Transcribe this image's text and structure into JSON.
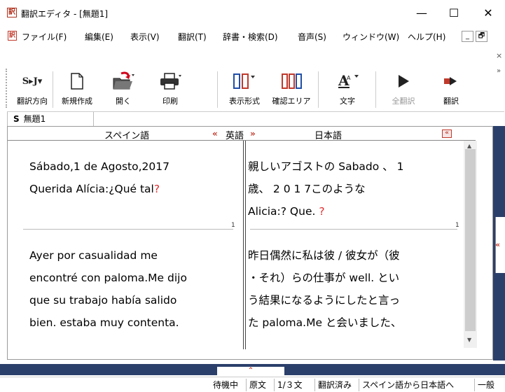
{
  "window": {
    "app_icon": "訳",
    "title": "翻訳エディタ - [無題1]",
    "minimize": "—",
    "maximize": "☐",
    "close": "✕"
  },
  "menu": {
    "doc_icon": "訳",
    "items": [
      "ファイル(F)",
      "編集(E)",
      "表示(V)",
      "翻訳(T)",
      "辞書・検索(D)",
      "音声(S)",
      "ウィンドウ(W)",
      "ヘルプ(H)"
    ],
    "mdi_min": "_",
    "mdi_restore": "🗗"
  },
  "toolbar": {
    "close": "×",
    "more": "»",
    "buttons": [
      {
        "label": "翻訳方向",
        "icon": "S▸J▾"
      },
      {
        "label": "新規作成",
        "icon": "new-doc-icon"
      },
      {
        "label": "開く",
        "icon": "open-folder-icon"
      },
      {
        "label": "印刷",
        "icon": "printer-icon"
      },
      {
        "label": "表示形式",
        "icon": "display-format-icon"
      },
      {
        "label": "確認エリア",
        "icon": "confirm-area-icon"
      },
      {
        "label": "文字",
        "icon": "font-icon"
      },
      {
        "label": "全翻訳",
        "icon": "play-icon"
      },
      {
        "label": "翻訳",
        "icon": "translate-icon"
      }
    ]
  },
  "tab": {
    "prefix": "S",
    "label": "無題1"
  },
  "editor": {
    "source_lang": "スペイン語",
    "pivot_lang": "英語",
    "target_lang": "日本語",
    "arrow_left": "«",
    "arrow_right": "»",
    "collapse": "«",
    "source": [
      {
        "lines": [
          "Sábado,1 de Agosto,2017",
          "Querida Alícia:¿Qué tal"
        ],
        "mark": "?",
        "num": "1"
      },
      {
        "lines": [
          "Ayer por casualidad me",
          "encontré con paloma.Me dijo",
          "que su trabajo había salido",
          "bien. estaba muy contenta."
        ]
      }
    ],
    "target": [
      {
        "lines": [
          "親しいアゴストの Sabado 、 1",
          "歳、 2 0 1 7このような",
          "Alicia:? Que. "
        ],
        "mark": "?",
        "num": "1"
      },
      {
        "lines": [
          "昨日偶然に私は彼 / 彼女が（彼",
          "・それ）らの仕事が well. とい",
          "う結果になるようにしたと言っ",
          "た paloma.Me と会いました、"
        ]
      }
    ],
    "scroll_up": "▲",
    "scroll_down": "▼"
  },
  "side": {
    "arrow": "«"
  },
  "bottom": {
    "arrow": "⌃"
  },
  "status": [
    "待機中",
    "原文",
    "1/３文",
    "翻訳済み",
    "スペイン語から日本語へ",
    "一般"
  ],
  "colors": {
    "accent": "#2b3f6b",
    "alert": "#e03030"
  }
}
